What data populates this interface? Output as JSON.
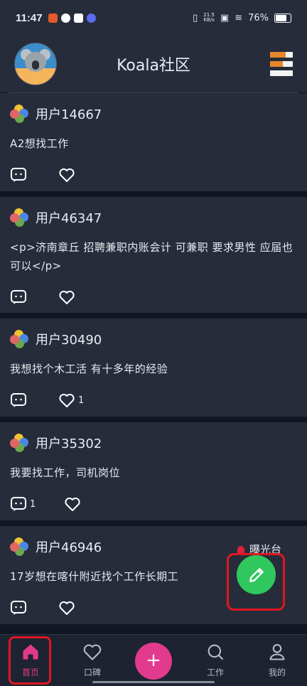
{
  "status_bar": {
    "time": "11:47",
    "net_speed_top": "21.5",
    "net_speed_bottom": "KB/s",
    "battery": "76%"
  },
  "header": {
    "title": "Koala社区",
    "avatar_icon": "koala-avatar-icon",
    "menu_icon": "menu-icon"
  },
  "posts": [
    {
      "username": "用户14667",
      "content": "A2想找工作",
      "comment_count": "",
      "like_count": ""
    },
    {
      "username": "用户46347",
      "content": "<p>济南章丘 招聘兼职内账会计 可兼职 要求男性 应届也可以</p>",
      "comment_count": "",
      "like_count": ""
    },
    {
      "username": "用户30490",
      "content": "我想找个木工活 有十多年的经验",
      "comment_count": "",
      "like_count": "1"
    },
    {
      "username": "用户35302",
      "content": "我要找工作，司机岗位",
      "comment_count": "1",
      "like_count": ""
    },
    {
      "username": "用户46946",
      "content": "17岁想在喀什附近找个工作长期工",
      "comment_count": "",
      "like_count": ""
    }
  ],
  "watermark": {
    "label": "曝光台"
  },
  "fab": {
    "icon": "edit-pencil-icon"
  },
  "bottom_nav": {
    "items": [
      {
        "label": "首页",
        "icon": "home-icon"
      },
      {
        "label": "口碑",
        "icon": "heart-icon"
      },
      {
        "label": "+",
        "icon": "add-icon"
      },
      {
        "label": "工作",
        "icon": "search-icon"
      },
      {
        "label": "我的",
        "icon": "user-icon"
      }
    ]
  },
  "colors": {
    "background": "#111722",
    "card": "#262c3a",
    "accent_pink": "#e23a8d",
    "fab_green": "#2fc75e",
    "highlight_red": "#e01722"
  }
}
